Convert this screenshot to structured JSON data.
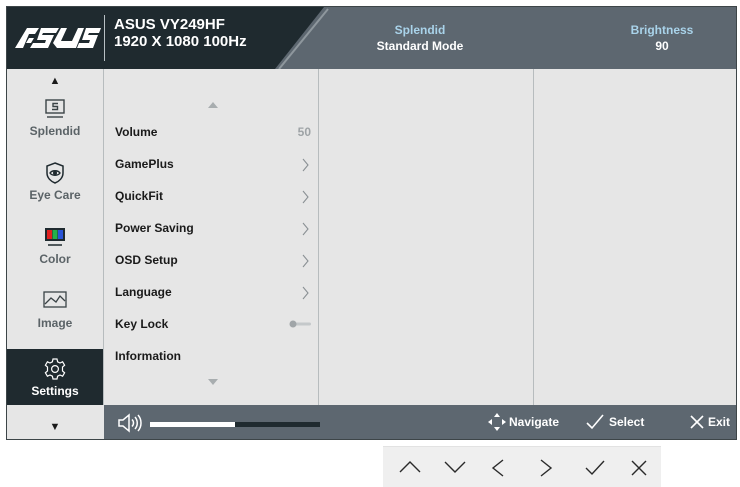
{
  "header": {
    "brand": "ASUS",
    "model_name": "ASUS VY249HF",
    "model_spec": "1920 X 1080 100Hz",
    "status": [
      {
        "label": "Splendid",
        "value": "Standard Mode"
      },
      {
        "label": "Brightness",
        "value": "90"
      }
    ]
  },
  "sidebar": {
    "items": [
      {
        "label": "Splendid",
        "icon": "splendid-icon"
      },
      {
        "label": "Eye Care",
        "icon": "eye-care-icon"
      },
      {
        "label": "Color",
        "icon": "color-icon"
      },
      {
        "label": "Image",
        "icon": "image-icon"
      },
      {
        "label": "Settings",
        "icon": "settings-icon",
        "active": true
      }
    ]
  },
  "menu": {
    "items": [
      {
        "label": "Volume",
        "value": "50"
      },
      {
        "label": "GamePlus"
      },
      {
        "label": "QuickFit"
      },
      {
        "label": "Power Saving"
      },
      {
        "label": "OSD Setup"
      },
      {
        "label": "Language"
      },
      {
        "label": "Key Lock",
        "toggle": "off"
      },
      {
        "label": "Information"
      }
    ]
  },
  "footer": {
    "volume_level": 0.5,
    "navigate_label": "Navigate",
    "select_label": "Select",
    "exit_label": "Exit"
  },
  "keys": [
    "up-key",
    "down-key",
    "left-key",
    "right-key",
    "confirm-key",
    "close-key"
  ],
  "colors": {
    "header_bg": "#5d6770",
    "brand_bg": "#1f2a2f",
    "header_label": "#a9d3ea",
    "panel_bg": "#e6e6e6",
    "active_bg": "#1f2a2f"
  }
}
